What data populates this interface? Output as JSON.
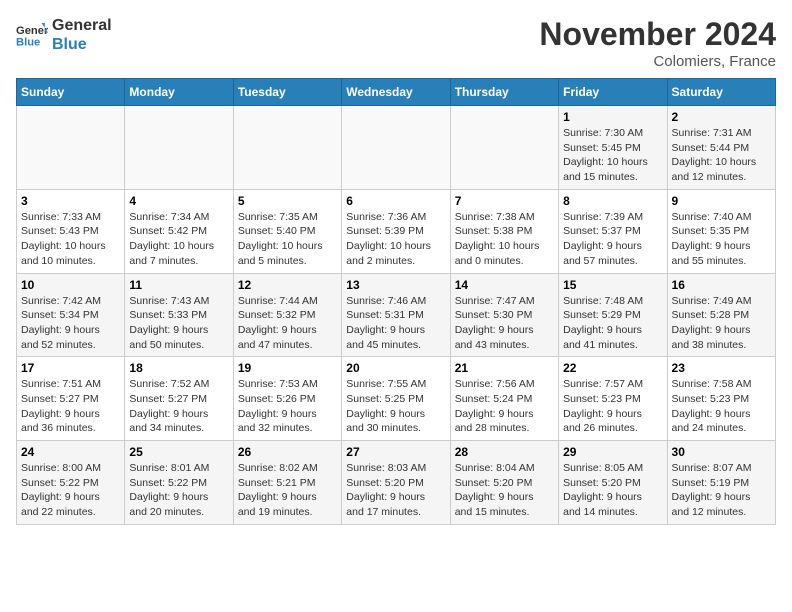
{
  "header": {
    "logo_line1": "General",
    "logo_line2": "Blue",
    "month": "November 2024",
    "location": "Colomiers, France"
  },
  "weekdays": [
    "Sunday",
    "Monday",
    "Tuesday",
    "Wednesday",
    "Thursday",
    "Friday",
    "Saturday"
  ],
  "weeks": [
    [
      {
        "day": "",
        "info": ""
      },
      {
        "day": "",
        "info": ""
      },
      {
        "day": "",
        "info": ""
      },
      {
        "day": "",
        "info": ""
      },
      {
        "day": "",
        "info": ""
      },
      {
        "day": "1",
        "info": "Sunrise: 7:30 AM\nSunset: 5:45 PM\nDaylight: 10 hours\nand 15 minutes."
      },
      {
        "day": "2",
        "info": "Sunrise: 7:31 AM\nSunset: 5:44 PM\nDaylight: 10 hours\nand 12 minutes."
      }
    ],
    [
      {
        "day": "3",
        "info": "Sunrise: 7:33 AM\nSunset: 5:43 PM\nDaylight: 10 hours\nand 10 minutes."
      },
      {
        "day": "4",
        "info": "Sunrise: 7:34 AM\nSunset: 5:42 PM\nDaylight: 10 hours\nand 7 minutes."
      },
      {
        "day": "5",
        "info": "Sunrise: 7:35 AM\nSunset: 5:40 PM\nDaylight: 10 hours\nand 5 minutes."
      },
      {
        "day": "6",
        "info": "Sunrise: 7:36 AM\nSunset: 5:39 PM\nDaylight: 10 hours\nand 2 minutes."
      },
      {
        "day": "7",
        "info": "Sunrise: 7:38 AM\nSunset: 5:38 PM\nDaylight: 10 hours\nand 0 minutes."
      },
      {
        "day": "8",
        "info": "Sunrise: 7:39 AM\nSunset: 5:37 PM\nDaylight: 9 hours\nand 57 minutes."
      },
      {
        "day": "9",
        "info": "Sunrise: 7:40 AM\nSunset: 5:35 PM\nDaylight: 9 hours\nand 55 minutes."
      }
    ],
    [
      {
        "day": "10",
        "info": "Sunrise: 7:42 AM\nSunset: 5:34 PM\nDaylight: 9 hours\nand 52 minutes."
      },
      {
        "day": "11",
        "info": "Sunrise: 7:43 AM\nSunset: 5:33 PM\nDaylight: 9 hours\nand 50 minutes."
      },
      {
        "day": "12",
        "info": "Sunrise: 7:44 AM\nSunset: 5:32 PM\nDaylight: 9 hours\nand 47 minutes."
      },
      {
        "day": "13",
        "info": "Sunrise: 7:46 AM\nSunset: 5:31 PM\nDaylight: 9 hours\nand 45 minutes."
      },
      {
        "day": "14",
        "info": "Sunrise: 7:47 AM\nSunset: 5:30 PM\nDaylight: 9 hours\nand 43 minutes."
      },
      {
        "day": "15",
        "info": "Sunrise: 7:48 AM\nSunset: 5:29 PM\nDaylight: 9 hours\nand 41 minutes."
      },
      {
        "day": "16",
        "info": "Sunrise: 7:49 AM\nSunset: 5:28 PM\nDaylight: 9 hours\nand 38 minutes."
      }
    ],
    [
      {
        "day": "17",
        "info": "Sunrise: 7:51 AM\nSunset: 5:27 PM\nDaylight: 9 hours\nand 36 minutes."
      },
      {
        "day": "18",
        "info": "Sunrise: 7:52 AM\nSunset: 5:27 PM\nDaylight: 9 hours\nand 34 minutes."
      },
      {
        "day": "19",
        "info": "Sunrise: 7:53 AM\nSunset: 5:26 PM\nDaylight: 9 hours\nand 32 minutes."
      },
      {
        "day": "20",
        "info": "Sunrise: 7:55 AM\nSunset: 5:25 PM\nDaylight: 9 hours\nand 30 minutes."
      },
      {
        "day": "21",
        "info": "Sunrise: 7:56 AM\nSunset: 5:24 PM\nDaylight: 9 hours\nand 28 minutes."
      },
      {
        "day": "22",
        "info": "Sunrise: 7:57 AM\nSunset: 5:23 PM\nDaylight: 9 hours\nand 26 minutes."
      },
      {
        "day": "23",
        "info": "Sunrise: 7:58 AM\nSunset: 5:23 PM\nDaylight: 9 hours\nand 24 minutes."
      }
    ],
    [
      {
        "day": "24",
        "info": "Sunrise: 8:00 AM\nSunset: 5:22 PM\nDaylight: 9 hours\nand 22 minutes."
      },
      {
        "day": "25",
        "info": "Sunrise: 8:01 AM\nSunset: 5:22 PM\nDaylight: 9 hours\nand 20 minutes."
      },
      {
        "day": "26",
        "info": "Sunrise: 8:02 AM\nSunset: 5:21 PM\nDaylight: 9 hours\nand 19 minutes."
      },
      {
        "day": "27",
        "info": "Sunrise: 8:03 AM\nSunset: 5:20 PM\nDaylight: 9 hours\nand 17 minutes."
      },
      {
        "day": "28",
        "info": "Sunrise: 8:04 AM\nSunset: 5:20 PM\nDaylight: 9 hours\nand 15 minutes."
      },
      {
        "day": "29",
        "info": "Sunrise: 8:05 AM\nSunset: 5:20 PM\nDaylight: 9 hours\nand 14 minutes."
      },
      {
        "day": "30",
        "info": "Sunrise: 8:07 AM\nSunset: 5:19 PM\nDaylight: 9 hours\nand 12 minutes."
      }
    ]
  ]
}
